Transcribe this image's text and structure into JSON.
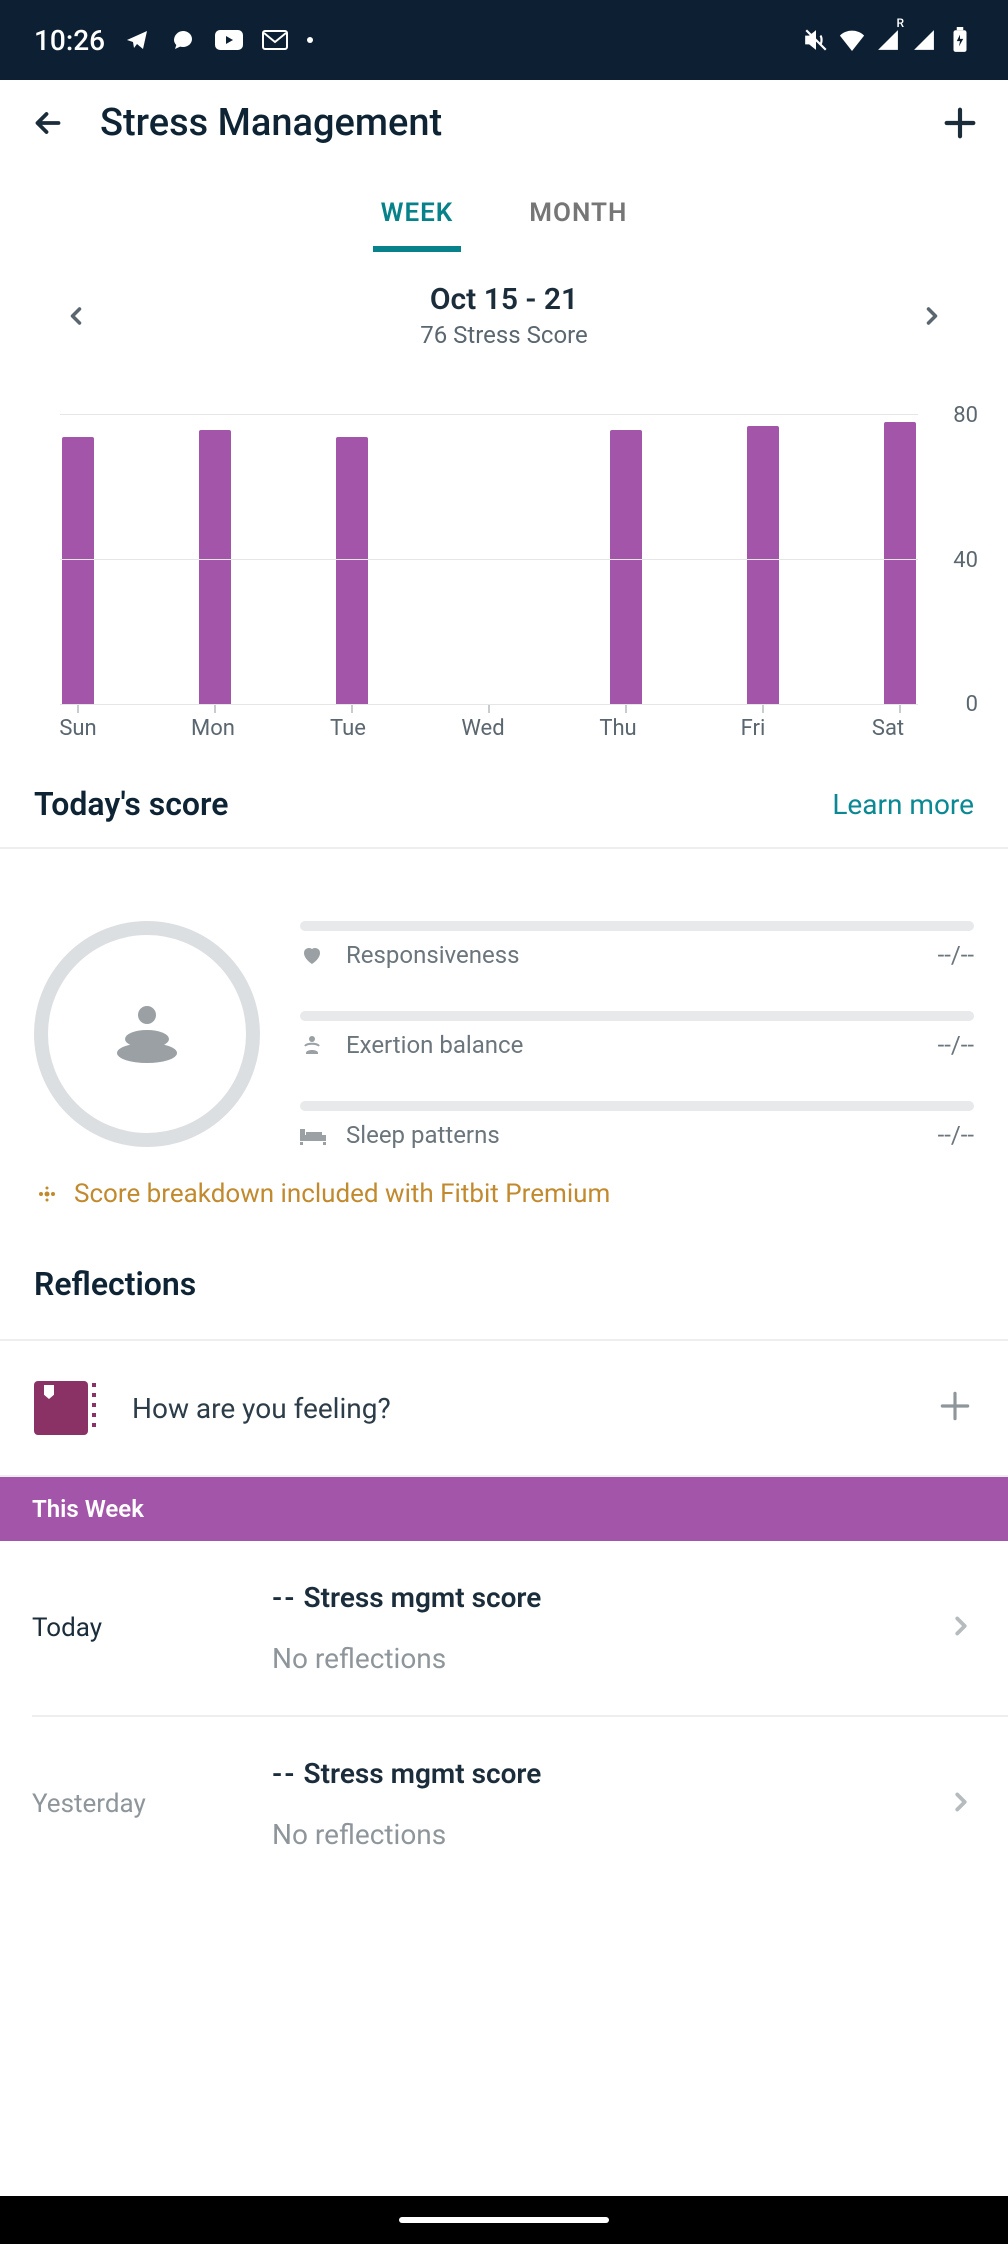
{
  "status": {
    "time": "10:26"
  },
  "header": {
    "title": "Stress Management"
  },
  "tabs": {
    "week": "WEEK",
    "month": "MONTH",
    "active": "week"
  },
  "date_nav": {
    "range": "Oct 15 - 21",
    "subtitle": "76 Stress Score"
  },
  "chart_data": {
    "type": "bar",
    "categories": [
      "Sun",
      "Mon",
      "Tue",
      "Wed",
      "Thu",
      "Fri",
      "Sat"
    ],
    "values": [
      74,
      76,
      74,
      null,
      76,
      77,
      78
    ],
    "ylim": [
      0,
      80
    ],
    "yticks": [
      0,
      40,
      80
    ],
    "color": "#a356a9"
  },
  "score": {
    "section_title": "Today's score",
    "learn_more": "Learn more",
    "metrics": [
      {
        "label": "Responsiveness",
        "value": "--/--"
      },
      {
        "label": "Exertion balance",
        "value": "--/--"
      },
      {
        "label": "Sleep patterns",
        "value": "--/--"
      }
    ],
    "premium_note": "Score breakdown included with Fitbit Premium"
  },
  "reflections": {
    "title": "Reflections",
    "prompt": "How are you feeling?"
  },
  "week": {
    "header": "This Week",
    "days": [
      {
        "label": "Today",
        "score_prefix": "--",
        "score_text": "Stress mgmt score",
        "reflection": "No reflections",
        "muted": false
      },
      {
        "label": "Yesterday",
        "score_prefix": "--",
        "score_text": "Stress mgmt score",
        "reflection": "No reflections",
        "muted": true
      }
    ]
  }
}
